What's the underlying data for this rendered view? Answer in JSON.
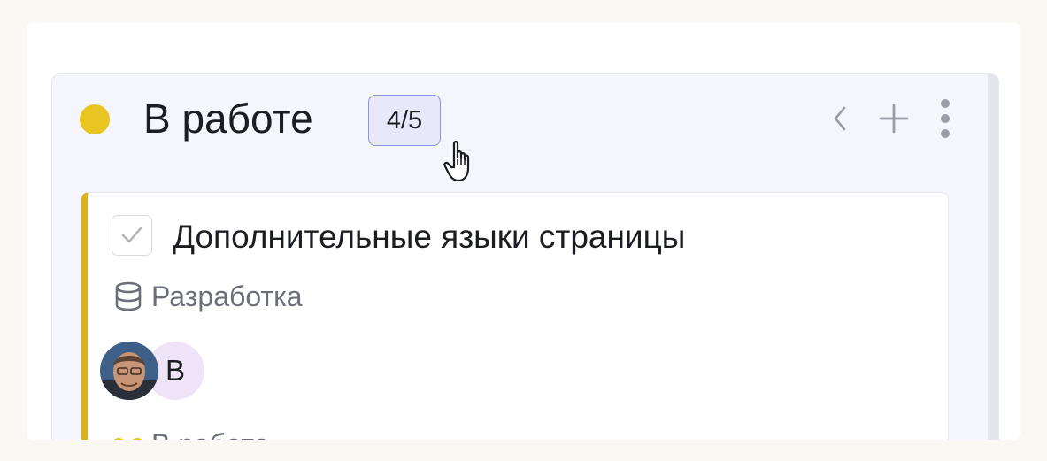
{
  "column": {
    "title": "В работе",
    "count_badge": "4/5",
    "status_color": "#e8c521",
    "actions": [
      "collapse-icon",
      "add-icon",
      "more-icon"
    ]
  },
  "card": {
    "title": "Дополнительные языки страницы",
    "project_icon": "database-icon",
    "project": "Разработка",
    "accent_color": "#dcb21d",
    "assignees": [
      {
        "type": "photo"
      },
      {
        "type": "initial",
        "initial": "В"
      }
    ],
    "status": "В работе"
  }
}
